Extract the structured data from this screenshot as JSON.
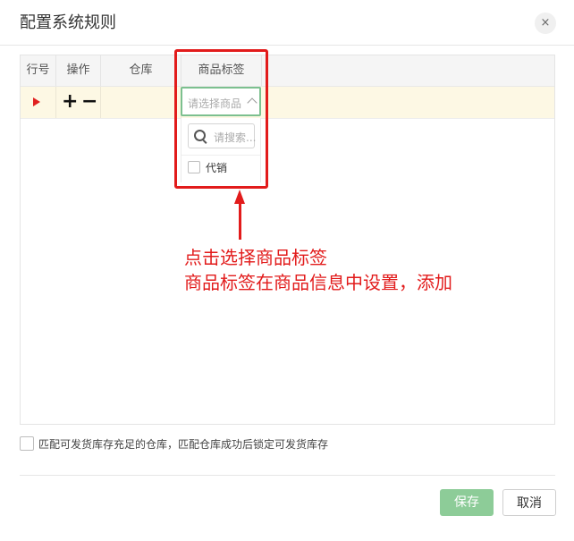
{
  "dialog": {
    "title": "配置系统规则",
    "close_glyph": "×"
  },
  "table": {
    "headers": [
      "行号",
      "操作",
      "仓库",
      "商品标签"
    ],
    "row": {
      "add_glyph": "+",
      "remove_glyph": "−"
    }
  },
  "tag_select": {
    "placeholder": "请选择商品",
    "search_placeholder": "请搜索...",
    "options": [
      "代销"
    ]
  },
  "annotation": {
    "line1": "点击选择商品标签",
    "line2": "商品标签在商品信息中设置，添加",
    "color": "#e21b1b"
  },
  "footer": {
    "option_label": "匹配可发货库存充足的仓库，匹配仓库成功后锁定可发货库存",
    "save_label": "保存",
    "cancel_label": "取消",
    "save_color": "#8dcc98"
  }
}
